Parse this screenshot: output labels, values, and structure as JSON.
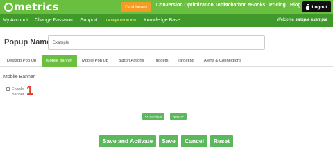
{
  "header": {
    "logo_text": "metrics",
    "dashboard_label": "Dashboard",
    "nav": [
      "Conversion Optimization Tools",
      "Ochatbot",
      "eBooks",
      "Pricing",
      "Blog"
    ],
    "logout_label": "Logout"
  },
  "subnav": {
    "my_account": "My Account",
    "change_password": "Change Password",
    "support": "Support",
    "trial_notice": "14 days left in trial",
    "knowledge_base": "Knowledge Base",
    "welcome_text": "Welcome",
    "welcome_user": "sample example"
  },
  "popup": {
    "label": "Popup Name",
    "value": "Example"
  },
  "tabs": [
    {
      "label": "Desktop Pop Up",
      "active": false
    },
    {
      "label": "Mobile Banner",
      "active": true
    },
    {
      "label": "Mobile Pop Up",
      "active": false
    },
    {
      "label": "Button Actions",
      "active": false
    },
    {
      "label": "Triggers",
      "active": false
    },
    {
      "label": "Targeting",
      "active": false
    },
    {
      "label": "Alerts & Connections",
      "active": false
    }
  ],
  "section": {
    "title": "Mobile Banner",
    "checkbox_label": "Enable Banner",
    "checked": false,
    "step_number": "1"
  },
  "pager": {
    "previous": "<< Previous",
    "next": "Next >>"
  },
  "actions": {
    "save_activate": "Save and Activate",
    "save": "Save",
    "cancel": "Cancel",
    "reset": "Reset"
  },
  "colors": {
    "brand_green": "#6abf40",
    "dark_green": "#3f9a2b",
    "button_green": "#5cb85c",
    "dashboard_orange": "#f59a23",
    "step_red": "#e3392f"
  }
}
